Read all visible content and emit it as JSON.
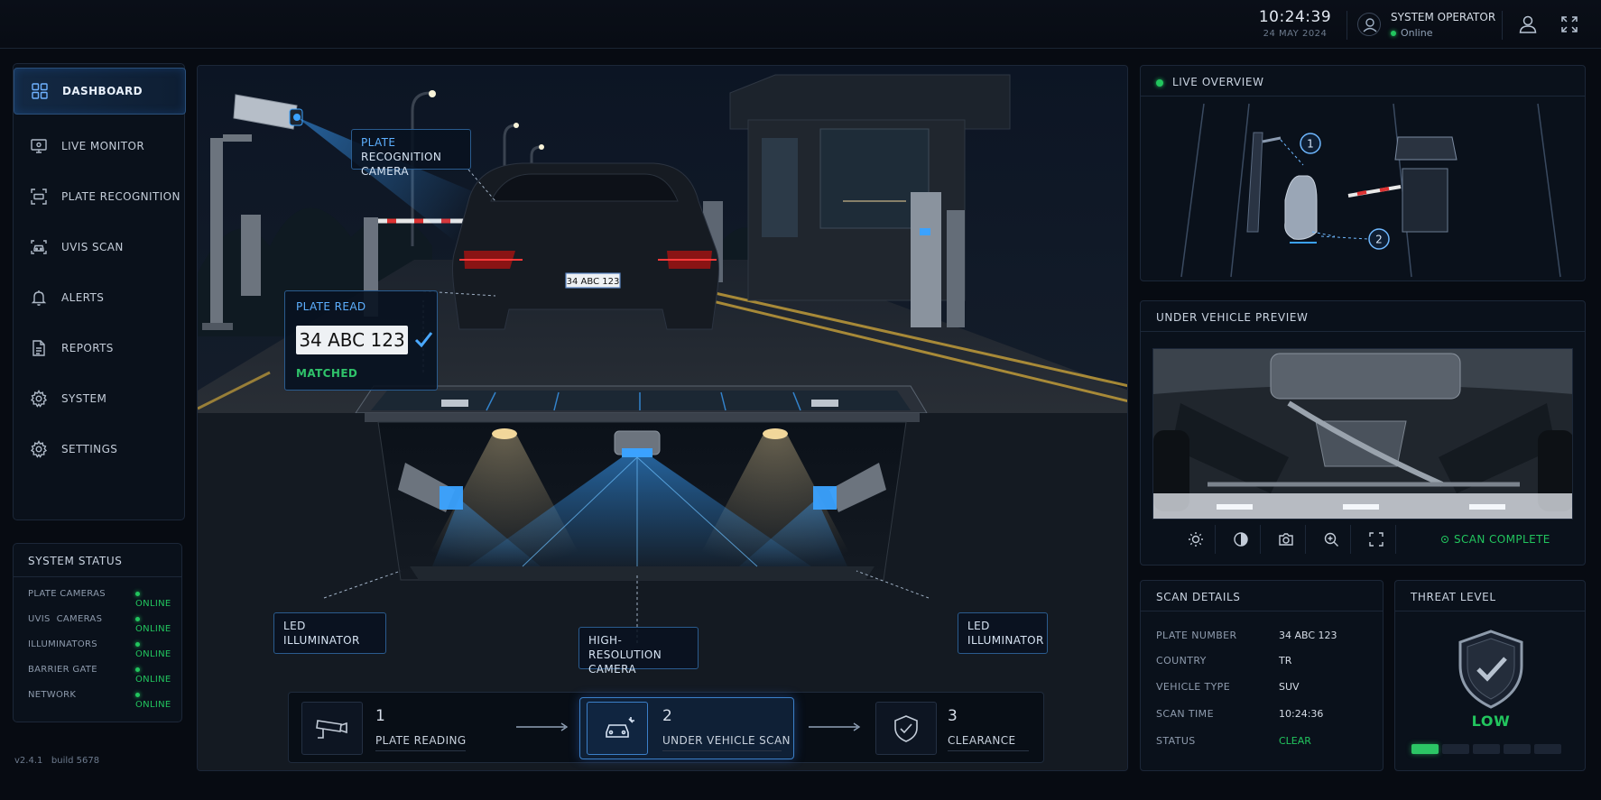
{
  "topbar": {
    "time": "10:24:39",
    "date": "24 MAY 2024",
    "operator_name": "SYSTEM OPERATOR",
    "operator_status": "Online"
  },
  "sidebar": {
    "items": [
      {
        "label": "DASHBOARD",
        "icon": "grid-icon"
      },
      {
        "label": "LIVE MONITOR",
        "icon": "monitor-icon"
      },
      {
        "label": "PLATE RECOGNITION",
        "icon": "plate-scan-icon"
      },
      {
        "label": "UVIS SCAN",
        "icon": "car-scan-icon"
      },
      {
        "label": "ALERTS",
        "icon": "bell-icon"
      },
      {
        "label": "REPORTS",
        "icon": "document-icon"
      },
      {
        "label": "SYSTEM",
        "icon": "gear-icon"
      },
      {
        "label": "SETTINGS",
        "icon": "gear-icon"
      }
    ]
  },
  "system_status": {
    "title": "SYSTEM STATUS",
    "rows": [
      {
        "label": "PLATE CAMERAS",
        "value": "ONLINE"
      },
      {
        "label": "UVIS  CAMERAS",
        "value": "ONLINE"
      },
      {
        "label": "ILLUMINATORS",
        "value": "ONLINE"
      },
      {
        "label": "BARRIER GATE",
        "value": "ONLINE"
      },
      {
        "label": "NETWORK",
        "value": "ONLINE"
      }
    ]
  },
  "version": "v2.4.1   build 5678",
  "scene": {
    "cam_label_1": "PLATE",
    "cam_label_2": "RECOGNITION",
    "cam_label_3": "CAMERA",
    "plate_read_title": "PLATE READ",
    "plate_read_value": "34 ABC 123",
    "plate_read_status": "MATCHED",
    "car_plate": "34 ABC 123",
    "led_left_1": "LED",
    "led_left_2": "ILLUMINATOR",
    "led_right_1": "LED",
    "led_right_2": "ILLUMINATOR",
    "hr_cam_1": "HIGH-RESOLUTION",
    "hr_cam_2": "CAMERA"
  },
  "steps": [
    {
      "num": "1",
      "label": "PLATE READING"
    },
    {
      "num": "2",
      "label": "UNDER VEHICLE SCAN"
    },
    {
      "num": "3",
      "label": "CLEARANCE"
    }
  ],
  "live_overview": {
    "title": "LIVE OVERVIEW",
    "marker_1": "1",
    "marker_2": "2"
  },
  "under_vehicle": {
    "title": "UNDER VEHICLE PREVIEW",
    "status": "SCAN COMPLETE"
  },
  "scan_details": {
    "title": "SCAN DETAILS",
    "rows": [
      {
        "label": "PLATE NUMBER",
        "value": "34 ABC 123"
      },
      {
        "label": "COUNTRY",
        "value": "TR"
      },
      {
        "label": "VEHICLE TYPE",
        "value": "SUV"
      },
      {
        "label": "SCAN TIME",
        "value": "10:24:36"
      },
      {
        "label": "STATUS",
        "value": "CLEAR"
      }
    ]
  },
  "threat": {
    "title": "THREAT LEVEL",
    "level": "LOW",
    "segments_active": 1,
    "segments_total": 5
  },
  "colors": {
    "accent": "#3b82f6",
    "online": "#22c55e",
    "background": "#070b12"
  }
}
